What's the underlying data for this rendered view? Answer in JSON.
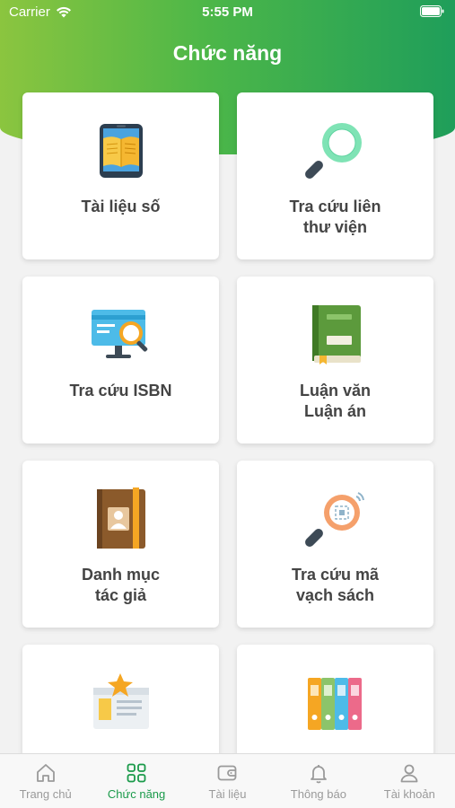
{
  "status_bar": {
    "carrier": "Carrier",
    "time": "5:55 PM"
  },
  "header": {
    "title": "Chức năng"
  },
  "cards": [
    {
      "label": "Tài liệu số",
      "icon": "ebook-icon"
    },
    {
      "label": "Tra cứu liên\nthư viện",
      "icon": "magnifier-icon"
    },
    {
      "label": "Tra cứu ISBN",
      "icon": "monitor-search-icon"
    },
    {
      "label": "Luận văn\nLuận án",
      "icon": "green-book-icon"
    },
    {
      "label": "Danh mục\ntác giả",
      "icon": "author-directory-icon"
    },
    {
      "label": "Tra cứu mã\nvạch sách",
      "icon": "barcode-search-icon"
    },
    {
      "label": "",
      "icon": "starred-document-icon"
    },
    {
      "label": "",
      "icon": "colored-binders-icon"
    }
  ],
  "tabbar": {
    "items": [
      {
        "label": "Trang chủ",
        "icon": "home-icon"
      },
      {
        "label": "Chức năng",
        "icon": "grid-icon",
        "active": true
      },
      {
        "label": "Tài liệu",
        "icon": "wallet-icon"
      },
      {
        "label": "Thông báo",
        "icon": "bell-icon"
      },
      {
        "label": "Tài khoản",
        "icon": "user-icon"
      }
    ],
    "active_color": "#1a9a4a",
    "inactive_color": "#9a9a9a"
  },
  "colors": {
    "header_start": "#8bc53f",
    "header_end": "#1f9e5a",
    "background": "#f2f2f2"
  }
}
